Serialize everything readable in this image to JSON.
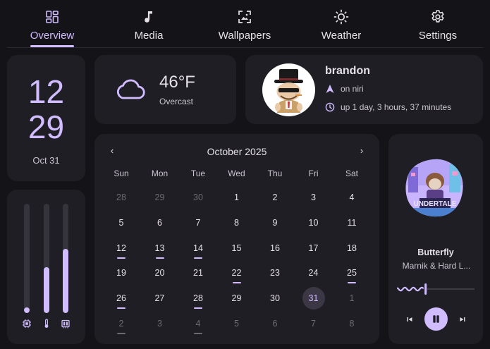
{
  "tabs": [
    {
      "label": "Overview",
      "icon": "dashboard-icon",
      "active": true
    },
    {
      "label": "Media",
      "icon": "music-note-icon"
    },
    {
      "label": "Wallpapers",
      "icon": "wallpaper-icon"
    },
    {
      "label": "Weather",
      "icon": "sun-icon"
    },
    {
      "label": "Settings",
      "icon": "gear-icon"
    }
  ],
  "clock": {
    "hour": "12",
    "minute": "29",
    "date": "Oct 31"
  },
  "weather": {
    "temperature": "46°F",
    "condition": "Overcast",
    "icon": "cloud-icon"
  },
  "user": {
    "name": "brandon",
    "wm": "on niri",
    "uptime": "up 1 day, 3 hours, 37 minutes"
  },
  "calendar": {
    "month": "October 2025",
    "weekdays": [
      "Sun",
      "Mon",
      "Tue",
      "Wed",
      "Thu",
      "Fri",
      "Sat"
    ],
    "weeks": [
      [
        {
          "d": "28",
          "o": 1
        },
        {
          "d": "29",
          "o": 1
        },
        {
          "d": "30",
          "o": 1
        },
        {
          "d": "1"
        },
        {
          "d": "2"
        },
        {
          "d": "3"
        },
        {
          "d": "4"
        }
      ],
      [
        {
          "d": "5"
        },
        {
          "d": "6"
        },
        {
          "d": "7"
        },
        {
          "d": "8"
        },
        {
          "d": "9"
        },
        {
          "d": "10"
        },
        {
          "d": "11"
        }
      ],
      [
        {
          "d": "12",
          "m": 1
        },
        {
          "d": "13",
          "m": 1
        },
        {
          "d": "14",
          "m": 1
        },
        {
          "d": "15"
        },
        {
          "d": "16"
        },
        {
          "d": "17"
        },
        {
          "d": "18"
        }
      ],
      [
        {
          "d": "19"
        },
        {
          "d": "20"
        },
        {
          "d": "21"
        },
        {
          "d": "22",
          "m": 1
        },
        {
          "d": "23"
        },
        {
          "d": "24"
        },
        {
          "d": "25",
          "m": 1
        }
      ],
      [
        {
          "d": "26",
          "m": 1
        },
        {
          "d": "27"
        },
        {
          "d": "28",
          "m": 1
        },
        {
          "d": "29"
        },
        {
          "d": "30"
        },
        {
          "d": "31",
          "t": 1
        },
        {
          "d": "1",
          "o": 1
        }
      ],
      [
        {
          "d": "2",
          "o": 1,
          "m": 1
        },
        {
          "d": "3",
          "o": 1
        },
        {
          "d": "4",
          "o": 1,
          "m": 1
        },
        {
          "d": "5",
          "o": 1
        },
        {
          "d": "6",
          "o": 1
        },
        {
          "d": "7",
          "o": 1
        },
        {
          "d": "8",
          "o": 1
        }
      ]
    ]
  },
  "resources": [
    {
      "name": "cpu",
      "level": 0.05,
      "icon": "cpu-chip-icon"
    },
    {
      "name": "temperature",
      "level": 0.42,
      "icon": "thermometer-icon"
    },
    {
      "name": "memory",
      "level": 0.59,
      "icon": "memory-icon"
    }
  ],
  "media": {
    "title": "Butterfly",
    "artist": "Marnik & Hard L...",
    "progress": 0.37,
    "state": "playing"
  },
  "colors": {
    "accent": "#d0bcff",
    "card": "#1f1e24",
    "background": "#141317"
  }
}
